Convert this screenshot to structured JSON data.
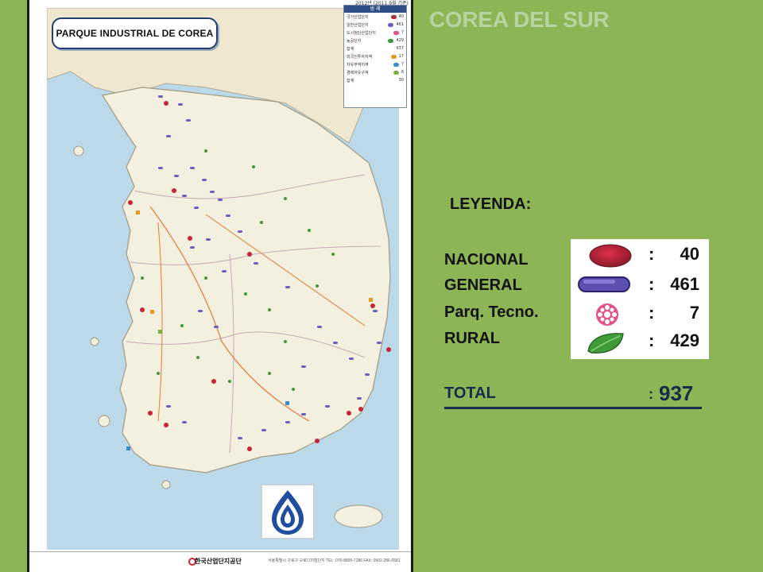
{
  "page": {
    "title": "COREA DEL SUR",
    "title_color": "#b9d3a0",
    "background": "#8db556"
  },
  "map": {
    "title": "PARQUE INDUSTRIAL DE COREA",
    "date_stamp": "2012년 (2011.9월 기준)",
    "mini_legend": {
      "header": "범 례",
      "rows": [
        {
          "label": "국가산업단지",
          "value": "40",
          "color": "#b0303a"
        },
        {
          "label": "일반산업단지",
          "value": "461",
          "color": "#6a5fc0"
        },
        {
          "label": "도시첨단산업단지",
          "value": "7",
          "color": "#e0508a"
        },
        {
          "label": "농공단지",
          "value": "429",
          "color": "#3a9a3a"
        },
        {
          "label": "합계",
          "value": "937",
          "color": ""
        },
        {
          "label": "외국인투자지역",
          "value": "17",
          "color": "#e89a20"
        },
        {
          "label": "자유무역지역",
          "value": "7",
          "color": "#3a8ad0"
        },
        {
          "label": "경제자유구역",
          "value": "6",
          "color": "#7ab040"
        },
        {
          "label": "합계",
          "value": "30",
          "color": ""
        }
      ]
    },
    "footer_org": "한국산업단지공단",
    "footer_info": "서울특별시 구로구 구로디지털단지 TEL: 070-8895-7286 FAX: 0502-286-0581"
  },
  "legend": {
    "heading": "LEYENDA:",
    "categories": [
      {
        "label": "NACIONAL",
        "count": "40",
        "icon": "red-ellipse-icon",
        "color": "#b8243a"
      },
      {
        "label": "GENERAL",
        "count": "461",
        "icon": "purple-capsule-icon",
        "color": "#5b4fb0"
      },
      {
        "label": "Parq. Tecno.",
        "count": "7",
        "icon": "pink-flower-icon",
        "color": "#e0508a"
      },
      {
        "label": "RURAL",
        "count": "429",
        "icon": "green-leaf-icon",
        "color": "#3f9a3a"
      }
    ],
    "total_label": "TOTAL",
    "total_colon": ":",
    "total_value": "937"
  }
}
